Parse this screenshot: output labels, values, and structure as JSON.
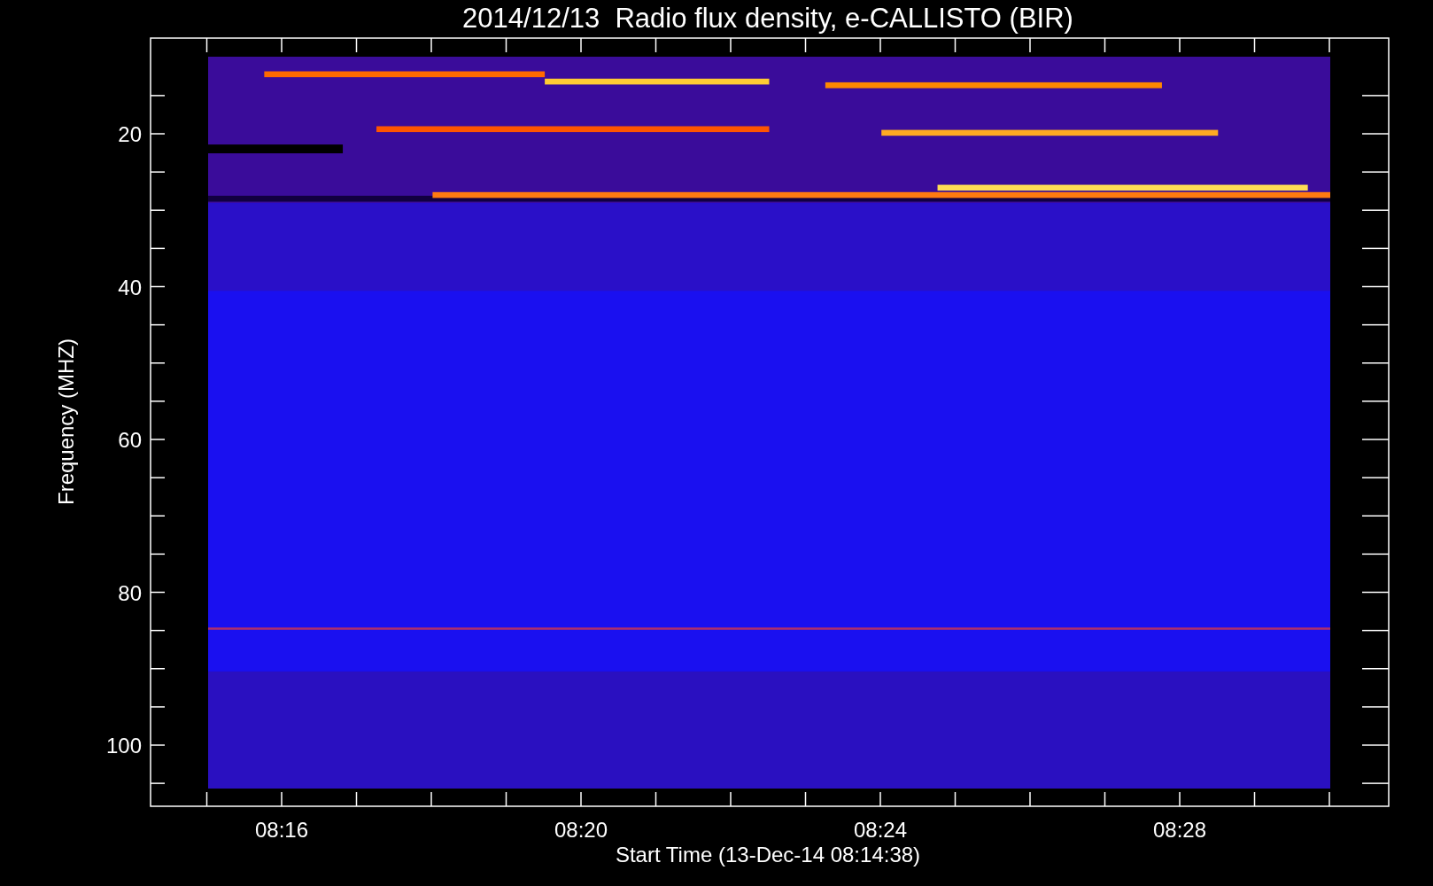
{
  "title": "2014/12/13  Radio flux density, e-CALLISTO (BIR)",
  "y_axis": {
    "label": "Frequency (MHZ)",
    "ticks": [
      "20",
      "40",
      "60",
      "80",
      "100"
    ]
  },
  "x_axis": {
    "label": "Start Time (13-Dec-14 08:14:38)",
    "ticks": [
      "08:16",
      "08:20",
      "08:24",
      "08:28"
    ]
  }
}
